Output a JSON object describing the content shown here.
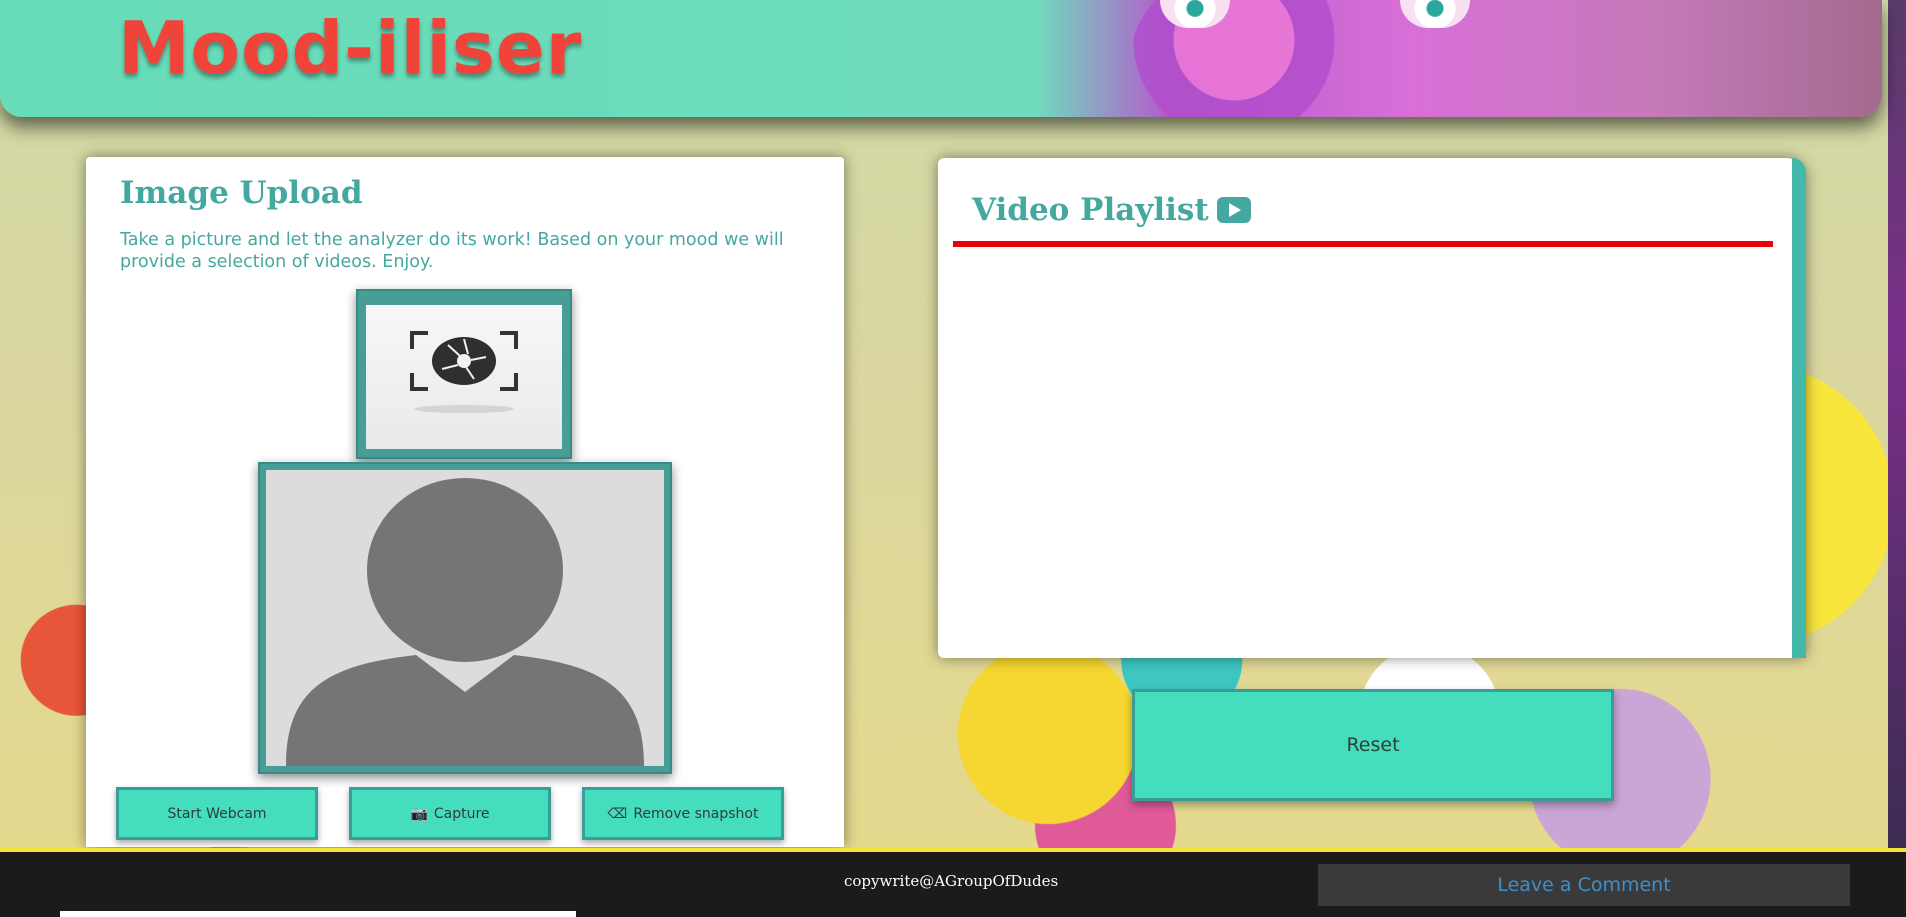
{
  "header": {
    "site_title": "Mood-iliser"
  },
  "upload_card": {
    "title": "Image Upload",
    "description": "Take a picture and let the analyzer do its work! Based on your mood we will provide a selection of videos. Enjoy."
  },
  "buttons": {
    "start_webcam": "Start Webcam",
    "capture": "Capture",
    "remove_snapshot": "Remove snapshot",
    "capture_icon": "camera-icon",
    "remove_icon": "eraser-icon"
  },
  "playlist_card": {
    "title": "Video Playlist",
    "icon": "youtube-icon"
  },
  "reset_button": "Reset",
  "footer": {
    "copyright": "copywrite@AGroupOfDudes",
    "comment_button": "Leave a Comment"
  },
  "colors": {
    "accent": "#44ddbd",
    "heading": "#45a8a0",
    "title_red": "#f0443a",
    "rule_red": "#e8000b",
    "footer_bg": "#1d1a1c"
  }
}
